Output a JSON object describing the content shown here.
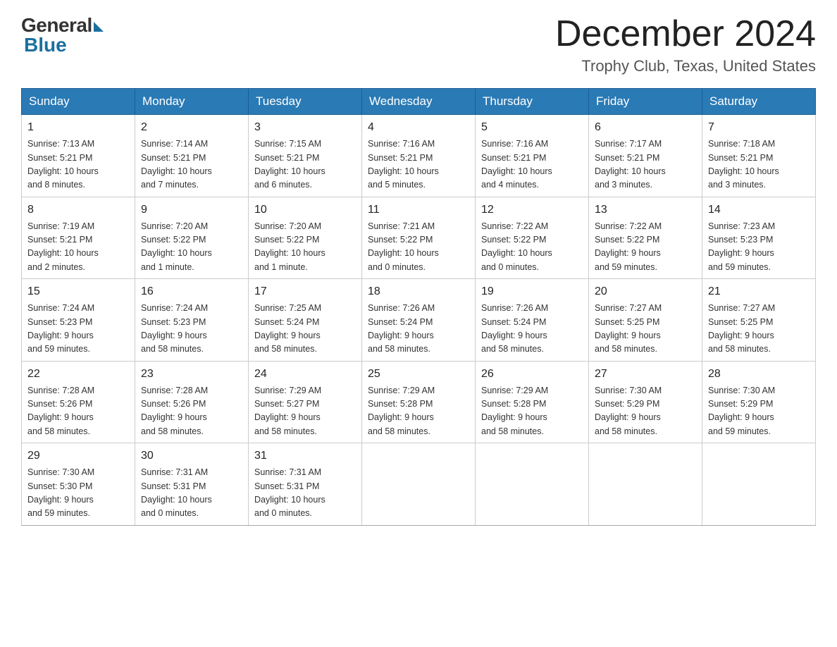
{
  "header": {
    "logo_general": "General",
    "logo_blue": "Blue",
    "month_title": "December 2024",
    "location": "Trophy Club, Texas, United States"
  },
  "days_of_week": [
    "Sunday",
    "Monday",
    "Tuesday",
    "Wednesday",
    "Thursday",
    "Friday",
    "Saturday"
  ],
  "weeks": [
    [
      {
        "day": "1",
        "info": "Sunrise: 7:13 AM\nSunset: 5:21 PM\nDaylight: 10 hours\nand 8 minutes."
      },
      {
        "day": "2",
        "info": "Sunrise: 7:14 AM\nSunset: 5:21 PM\nDaylight: 10 hours\nand 7 minutes."
      },
      {
        "day": "3",
        "info": "Sunrise: 7:15 AM\nSunset: 5:21 PM\nDaylight: 10 hours\nand 6 minutes."
      },
      {
        "day": "4",
        "info": "Sunrise: 7:16 AM\nSunset: 5:21 PM\nDaylight: 10 hours\nand 5 minutes."
      },
      {
        "day": "5",
        "info": "Sunrise: 7:16 AM\nSunset: 5:21 PM\nDaylight: 10 hours\nand 4 minutes."
      },
      {
        "day": "6",
        "info": "Sunrise: 7:17 AM\nSunset: 5:21 PM\nDaylight: 10 hours\nand 3 minutes."
      },
      {
        "day": "7",
        "info": "Sunrise: 7:18 AM\nSunset: 5:21 PM\nDaylight: 10 hours\nand 3 minutes."
      }
    ],
    [
      {
        "day": "8",
        "info": "Sunrise: 7:19 AM\nSunset: 5:21 PM\nDaylight: 10 hours\nand 2 minutes."
      },
      {
        "day": "9",
        "info": "Sunrise: 7:20 AM\nSunset: 5:22 PM\nDaylight: 10 hours\nand 1 minute."
      },
      {
        "day": "10",
        "info": "Sunrise: 7:20 AM\nSunset: 5:22 PM\nDaylight: 10 hours\nand 1 minute."
      },
      {
        "day": "11",
        "info": "Sunrise: 7:21 AM\nSunset: 5:22 PM\nDaylight: 10 hours\nand 0 minutes."
      },
      {
        "day": "12",
        "info": "Sunrise: 7:22 AM\nSunset: 5:22 PM\nDaylight: 10 hours\nand 0 minutes."
      },
      {
        "day": "13",
        "info": "Sunrise: 7:22 AM\nSunset: 5:22 PM\nDaylight: 9 hours\nand 59 minutes."
      },
      {
        "day": "14",
        "info": "Sunrise: 7:23 AM\nSunset: 5:23 PM\nDaylight: 9 hours\nand 59 minutes."
      }
    ],
    [
      {
        "day": "15",
        "info": "Sunrise: 7:24 AM\nSunset: 5:23 PM\nDaylight: 9 hours\nand 59 minutes."
      },
      {
        "day": "16",
        "info": "Sunrise: 7:24 AM\nSunset: 5:23 PM\nDaylight: 9 hours\nand 58 minutes."
      },
      {
        "day": "17",
        "info": "Sunrise: 7:25 AM\nSunset: 5:24 PM\nDaylight: 9 hours\nand 58 minutes."
      },
      {
        "day": "18",
        "info": "Sunrise: 7:26 AM\nSunset: 5:24 PM\nDaylight: 9 hours\nand 58 minutes."
      },
      {
        "day": "19",
        "info": "Sunrise: 7:26 AM\nSunset: 5:24 PM\nDaylight: 9 hours\nand 58 minutes."
      },
      {
        "day": "20",
        "info": "Sunrise: 7:27 AM\nSunset: 5:25 PM\nDaylight: 9 hours\nand 58 minutes."
      },
      {
        "day": "21",
        "info": "Sunrise: 7:27 AM\nSunset: 5:25 PM\nDaylight: 9 hours\nand 58 minutes."
      }
    ],
    [
      {
        "day": "22",
        "info": "Sunrise: 7:28 AM\nSunset: 5:26 PM\nDaylight: 9 hours\nand 58 minutes."
      },
      {
        "day": "23",
        "info": "Sunrise: 7:28 AM\nSunset: 5:26 PM\nDaylight: 9 hours\nand 58 minutes."
      },
      {
        "day": "24",
        "info": "Sunrise: 7:29 AM\nSunset: 5:27 PM\nDaylight: 9 hours\nand 58 minutes."
      },
      {
        "day": "25",
        "info": "Sunrise: 7:29 AM\nSunset: 5:28 PM\nDaylight: 9 hours\nand 58 minutes."
      },
      {
        "day": "26",
        "info": "Sunrise: 7:29 AM\nSunset: 5:28 PM\nDaylight: 9 hours\nand 58 minutes."
      },
      {
        "day": "27",
        "info": "Sunrise: 7:30 AM\nSunset: 5:29 PM\nDaylight: 9 hours\nand 58 minutes."
      },
      {
        "day": "28",
        "info": "Sunrise: 7:30 AM\nSunset: 5:29 PM\nDaylight: 9 hours\nand 59 minutes."
      }
    ],
    [
      {
        "day": "29",
        "info": "Sunrise: 7:30 AM\nSunset: 5:30 PM\nDaylight: 9 hours\nand 59 minutes."
      },
      {
        "day": "30",
        "info": "Sunrise: 7:31 AM\nSunset: 5:31 PM\nDaylight: 10 hours\nand 0 minutes."
      },
      {
        "day": "31",
        "info": "Sunrise: 7:31 AM\nSunset: 5:31 PM\nDaylight: 10 hours\nand 0 minutes."
      },
      {
        "day": "",
        "info": ""
      },
      {
        "day": "",
        "info": ""
      },
      {
        "day": "",
        "info": ""
      },
      {
        "day": "",
        "info": ""
      }
    ]
  ]
}
